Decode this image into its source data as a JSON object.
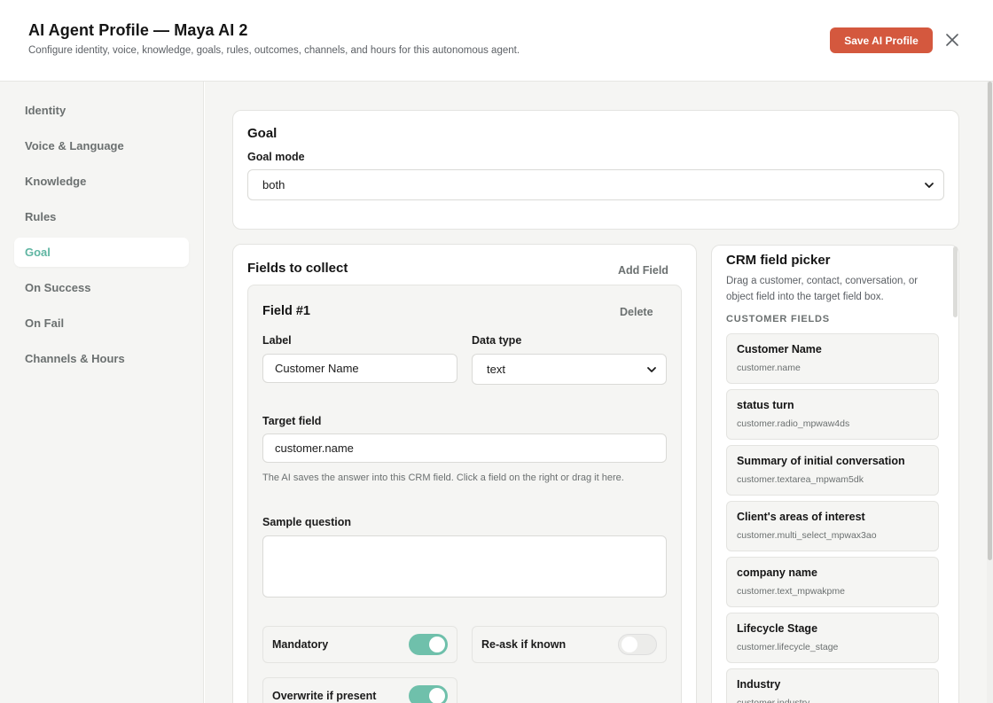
{
  "header": {
    "title": "AI Agent Profile — Maya AI 2",
    "subtitle": "Configure identity, voice, knowledge, goals, rules, outcomes, channels, and hours for this autonomous agent.",
    "save_label": "Save AI Profile",
    "accent_color": "#d4583e"
  },
  "sidebar": {
    "active_color": "#5fb5a2",
    "items": [
      {
        "label": "Identity"
      },
      {
        "label": "Voice & Language"
      },
      {
        "label": "Knowledge"
      },
      {
        "label": "Rules"
      },
      {
        "label": "Goal",
        "active": true
      },
      {
        "label": "On Success"
      },
      {
        "label": "On Fail"
      },
      {
        "label": "Channels & Hours"
      }
    ]
  },
  "goal": {
    "heading": "Goal",
    "mode_label": "Goal mode",
    "mode_value": "both"
  },
  "fields": {
    "heading": "Fields to collect",
    "add_label": "Add Field",
    "field1": {
      "heading": "Field #1",
      "delete_label": "Delete",
      "label_label": "Label",
      "label_value": "Customer Name",
      "type_label": "Data type",
      "type_value": "text",
      "target_label": "Target field",
      "target_value": "customer.name",
      "target_help": "The AI saves the answer into this CRM field. Click a field on the right or drag it here.",
      "sample_label": "Sample question",
      "sample_value": "",
      "toggles": {
        "mandatory": {
          "label": "Mandatory",
          "on": true
        },
        "reask": {
          "label": "Re-ask if known",
          "on": false
        },
        "overwrite": {
          "label": "Overwrite if present",
          "on": true
        }
      }
    }
  },
  "crm": {
    "title": "CRM field picker",
    "description": "Drag a customer, contact, conversation, or object field into the target field box.",
    "section": "CUSTOMER FIELDS",
    "items": [
      {
        "name": "Customer Name",
        "key": "customer.name"
      },
      {
        "name": "status turn",
        "key": "customer.radio_mpwaw4ds"
      },
      {
        "name": "Summary of initial conversation",
        "key": "customer.textarea_mpwam5dk"
      },
      {
        "name": "Client's areas of interest",
        "key": "customer.multi_select_mpwax3ao"
      },
      {
        "name": "company name",
        "key": "customer.text_mpwakpme"
      },
      {
        "name": "Lifecycle Stage",
        "key": "customer.lifecycle_stage"
      },
      {
        "name": "Industry",
        "key": "customer.industry"
      }
    ]
  }
}
